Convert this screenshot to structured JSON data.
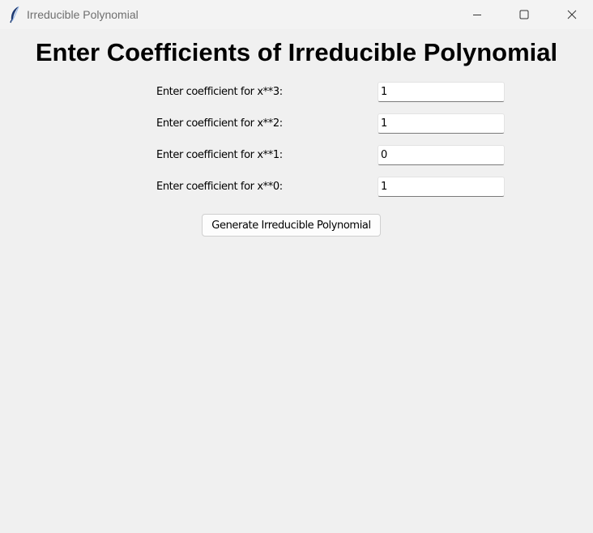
{
  "window": {
    "title": "Irreducible Polynomial",
    "icon": "feather-icon",
    "controls": [
      "minimize-icon",
      "maximize-icon",
      "close-icon"
    ]
  },
  "main": {
    "heading": "Enter Coefficients of Irreducible Polynomial",
    "fields": [
      {
        "label": "Enter coefficient for x**3:",
        "value": "1"
      },
      {
        "label": "Enter coefficient for x**2:",
        "value": "1"
      },
      {
        "label": "Enter coefficient for x**1:",
        "value": "0"
      },
      {
        "label": "Enter coefficient for x**0:",
        "value": "1"
      }
    ],
    "generate_label": "Generate Irreducible Polynomial"
  },
  "colors": {
    "background": "#f0f0f0",
    "titlebar": "#f3f3f3",
    "input_background": "#ffffff"
  }
}
